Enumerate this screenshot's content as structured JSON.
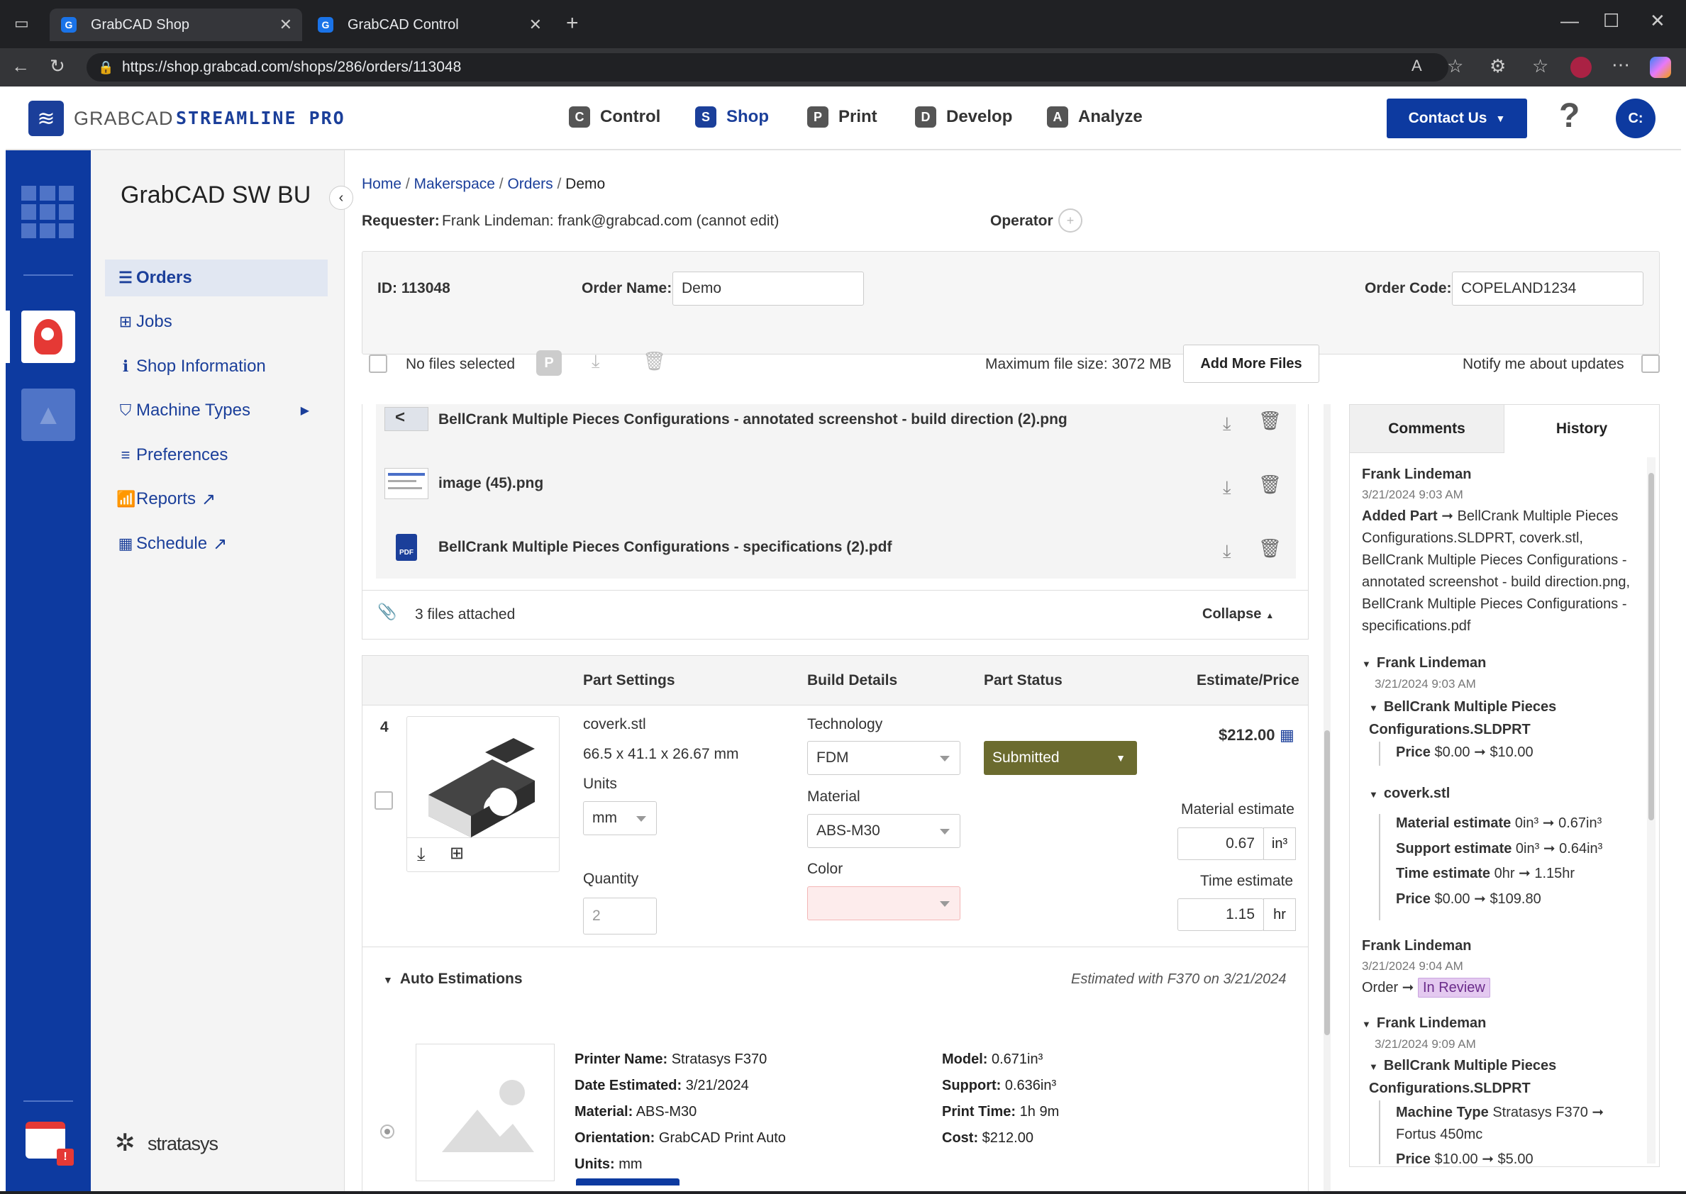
{
  "browser": {
    "tabs": [
      {
        "title": "GrabCAD Shop"
      },
      {
        "title": "GrabCAD Control"
      }
    ],
    "url": "https://shop.grabcad.com/shops/286/orders/113048"
  },
  "header": {
    "logo_left": "GRABCAD",
    "logo_right": "STREAMLINE PRO",
    "nav": [
      {
        "letter": "C",
        "label": "Control"
      },
      {
        "letter": "S",
        "label": "Shop"
      },
      {
        "letter": "P",
        "label": "Print"
      },
      {
        "letter": "D",
        "label": "Develop"
      },
      {
        "letter": "A",
        "label": "Analyze"
      }
    ],
    "contact": "Contact Us",
    "help": "?",
    "avatar": "C:"
  },
  "sidebar": {
    "shop_name": "GrabCAD SW BU",
    "items": [
      {
        "label": "Orders"
      },
      {
        "label": "Jobs"
      },
      {
        "label": "Shop Information"
      },
      {
        "label": "Machine Types"
      },
      {
        "label": "Preferences"
      },
      {
        "label": "Reports"
      },
      {
        "label": "Schedule"
      }
    ],
    "footer_logo": "stratasys"
  },
  "breadcrumb": {
    "home": "Home",
    "space": "Makerspace",
    "orders": "Orders",
    "current": "Demo"
  },
  "order": {
    "requester_label": "Requester:",
    "requester_value": "Frank Lindeman: frank@grabcad.com (cannot edit)",
    "operator_label": "Operator",
    "id_label": "ID: 113048",
    "name_label": "Order Name:",
    "name_value": "Demo",
    "code_label": "Order Code:",
    "code_value": "COPELAND1234"
  },
  "files": {
    "none_selected": "No files selected",
    "max_size": "Maximum file size: 3072 MB",
    "add_button": "Add More Files",
    "notify": "Notify me about updates",
    "list": [
      {
        "name": "BellCrank Multiple Pieces Configurations - annotated screenshot - build direction (2).png"
      },
      {
        "name": "image (45).png"
      },
      {
        "name": "BellCrank Multiple Pieces Configurations - specifications (2).pdf",
        "badge": "PDF"
      }
    ],
    "attached": "3 files attached",
    "collapse": "Collapse"
  },
  "part": {
    "headers": {
      "settings": "Part Settings",
      "build": "Build Details",
      "status": "Part Status",
      "price": "Estimate/Price"
    },
    "index": "4",
    "filename": "coverk.stl",
    "dims": "66.5 x 41.1 x 26.67 mm",
    "units_label": "Units",
    "units_value": "mm",
    "quantity_label": "Quantity",
    "quantity_value": "2",
    "technology_label": "Technology",
    "technology_value": "FDM",
    "material_label": "Material",
    "material_value": "ABS-M30",
    "color_label": "Color",
    "status_value": "Submitted",
    "status_color": "#6b6b2f",
    "price": "$212.00",
    "material_est_label": "Material estimate",
    "material_est_value": "0.67",
    "material_est_unit": "in³",
    "time_est_label": "Time estimate",
    "time_est_value": "1.15",
    "time_est_unit": "hr"
  },
  "auto": {
    "title": "Auto Estimations",
    "estimated_with": "Estimated with F370 on 3/21/2024",
    "left": [
      {
        "k": "Printer Name:",
        "v": "Stratasys F370"
      },
      {
        "k": "Date Estimated:",
        "v": "3/21/2024"
      },
      {
        "k": "Material:",
        "v": "ABS-M30"
      },
      {
        "k": "Orientation:",
        "v": "GrabCAD Print Auto"
      },
      {
        "k": "Units:",
        "v": "mm"
      }
    ],
    "right": [
      {
        "k": "Model:",
        "v": "0.671in³"
      },
      {
        "k": "Support:",
        "v": "0.636in³"
      },
      {
        "k": "Print Time:",
        "v": "1h 9m"
      },
      {
        "k": "Cost:",
        "v": "$212.00"
      }
    ]
  },
  "history": {
    "tabs": {
      "comments": "Comments",
      "history": "History"
    },
    "e1": {
      "name": "Frank Lindeman",
      "date": "3/21/2024 9:03 AM",
      "action": "Added Part",
      "text": "BellCrank Multiple Pieces Configurations.SLDPRT, coverk.stl, BellCrank Multiple Pieces Configurations - annotated screenshot - build direction.png, BellCrank Multiple Pieces Configurations - specifications.pdf"
    },
    "e2": {
      "name": "Frank Lindeman",
      "date": "3/21/2024 9:03 AM",
      "part1": "BellCrank Multiple Pieces Configurations.SLDPRT",
      "p1_label": "Price",
      "p1_from": "$0.00",
      "p1_to": "$10.00",
      "part2": "coverk.stl",
      "rows": [
        {
          "k": "Material estimate",
          "from": "0in³",
          "to": "0.67in³"
        },
        {
          "k": "Support estimate",
          "from": "0in³",
          "to": "0.64in³"
        },
        {
          "k": "Time estimate",
          "from": "0hr",
          "to": "1.15hr"
        },
        {
          "k": "Price",
          "from": "$0.00",
          "to": "$109.80"
        }
      ]
    },
    "e3": {
      "name": "Frank Lindeman",
      "date": "3/21/2024 9:04 AM",
      "order": "Order",
      "status": "In Review"
    },
    "e4": {
      "name": "Frank Lindeman",
      "date": "3/21/2024 9:09 AM",
      "part": "BellCrank Multiple Pieces Configurations.SLDPRT",
      "mt_label": "Machine Type",
      "mt_from": "Stratasys F370",
      "mt_to": "Fortus 450mc",
      "price_label": "Price",
      "price_from": "$10.00",
      "price_to": "$5.00"
    }
  }
}
